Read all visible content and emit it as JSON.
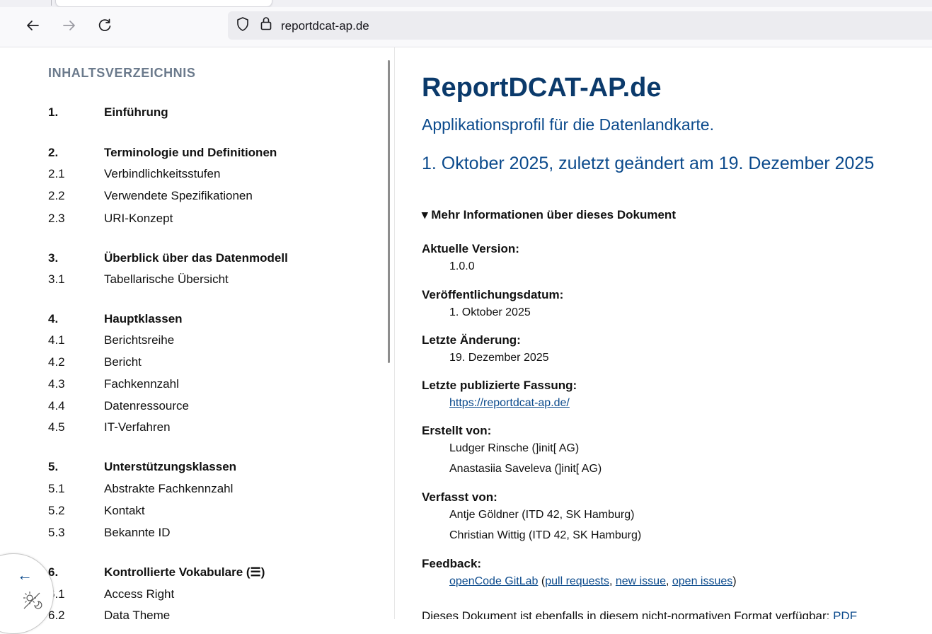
{
  "browser": {
    "url": "reportdcat-ap.de"
  },
  "toc": {
    "title": "INHALTSVERZEICHNIS",
    "items": [
      {
        "num": "1.",
        "label": "Einführung"
      },
      {
        "num": "2.",
        "label": "Terminologie und Definitionen"
      },
      {
        "num": "2.1",
        "label": "Verbindlichkeitsstufen"
      },
      {
        "num": "2.2",
        "label": "Verwendete Spezifikationen"
      },
      {
        "num": "2.3",
        "label": "URI-Konzept"
      },
      {
        "num": "3.",
        "label": "Überblick über das Datenmodell"
      },
      {
        "num": "3.1",
        "label": "Tabellarische Übersicht"
      },
      {
        "num": "4.",
        "label": "Hauptklassen"
      },
      {
        "num": "4.1",
        "label": "Berichtsreihe"
      },
      {
        "num": "4.2",
        "label": "Bericht"
      },
      {
        "num": "4.3",
        "label": "Fachkennzahl"
      },
      {
        "num": "4.4",
        "label": "Datenressource"
      },
      {
        "num": "4.5",
        "label": "IT-Verfahren"
      },
      {
        "num": "5.",
        "label": "Unterstützungsklassen"
      },
      {
        "num": "5.1",
        "label": "Abstrakte Fachkennzahl"
      },
      {
        "num": "5.2",
        "label": "Kontakt"
      },
      {
        "num": "5.3",
        "label": "Bekannte ID"
      },
      {
        "num": "6.",
        "label": "Kontrollierte Vokabulare (☰)"
      },
      {
        "num": "6.1",
        "label": "Access Right"
      },
      {
        "num": "6.2",
        "label": "Data Theme"
      }
    ],
    "toggle_arrow": "←"
  },
  "doc": {
    "title": "ReportDCAT-AP.de",
    "subtitle": "Applikationsprofil für die Datenlandkarte.",
    "date": "1. Oktober 2025, zuletzt geändert am 19. Dezember 2025",
    "details_summary": "▾ Mehr Informationen über dieses Dokument",
    "meta": {
      "current_version_label": "Aktuelle Version:",
      "current_version": "1.0.0",
      "published_label": "Veröffentlichungsdatum:",
      "published": "1. Oktober 2025",
      "modified_label": "Letzte Änderung:",
      "modified": "19. Dezember 2025",
      "latest_label": "Letzte publizierte Fassung:",
      "latest_link": "https://reportdcat-ap.de/",
      "created_by_label": "Erstellt von:",
      "created_by": [
        "Ludger Rinsche (]init[ AG)",
        "Anastasiia Saveleva (]init[ AG)"
      ],
      "authored_by_label": "Verfasst von:",
      "authored_by": [
        "Antje Göldner (ITD 42, SK Hamburg)",
        "Christian Wittig (ITD 42, SK Hamburg)"
      ],
      "feedback_label": "Feedback:",
      "feedback_link": "openCode GitLab",
      "feedback_open_paren": " (",
      "feedback_pull": "pull requests",
      "feedback_sep1": ", ",
      "feedback_new": "new issue",
      "feedback_sep2": ", ",
      "feedback_open": "open issues",
      "feedback_close_paren": ")"
    },
    "format_note": "Dieses Dokument ist ebenfalls in diesem nicht-normativen Format verfügbar: ",
    "format_link": "PDF"
  }
}
